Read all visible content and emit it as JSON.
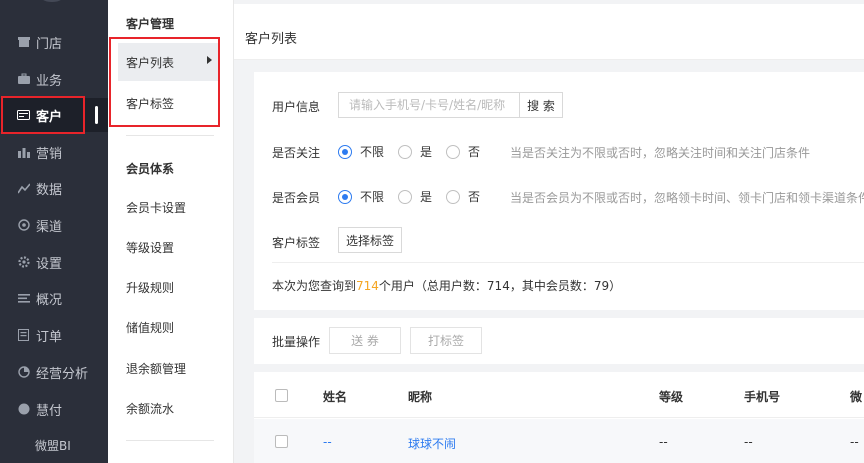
{
  "nav": {
    "items": [
      {
        "label": "门店",
        "icon": "store-icon"
      },
      {
        "label": "业务",
        "icon": "briefcase-icon"
      },
      {
        "label": "客户",
        "icon": "customer-card-icon"
      },
      {
        "label": "营销",
        "icon": "bar-chart-icon"
      },
      {
        "label": "数据",
        "icon": "trend-icon"
      },
      {
        "label": "渠道",
        "icon": "channel-icon"
      },
      {
        "label": "设置",
        "icon": "gear-icon"
      },
      {
        "label": "概况",
        "icon": "list-icon"
      },
      {
        "label": "订单",
        "icon": "order-icon"
      },
      {
        "label": "经营分析",
        "icon": "analysis-icon"
      },
      {
        "label": "慧付",
        "icon": "pay-icon"
      },
      {
        "label": "微盟BI",
        "icon": ""
      }
    ],
    "active_index": 2
  },
  "subnav": {
    "group1": "客户管理",
    "group1_items": [
      "客户列表",
      "客户标签"
    ],
    "group2": "会员体系",
    "group2_items": [
      "会员卡设置",
      "等级设置",
      "升级规则",
      "储值规则",
      "退余额管理",
      "余额流水"
    ]
  },
  "page": {
    "title": "客户列表"
  },
  "filter": {
    "user_info_label": "用户信息",
    "search_placeholder": "请输入手机号/卡号/姓名/昵称",
    "search_button": "搜 索",
    "follow_label": "是否关注",
    "member_label": "是否会员",
    "options": [
      "不限",
      "是",
      "否"
    ],
    "follow_hint": "当是否关注为不限或否时，忽略关注时间和关注门店条件",
    "member_hint": "当是否会员为不限或否时，忽略领卡时间、领卡门店和领卡渠道条件",
    "tag_label": "客户标签",
    "tag_button": "选择标签",
    "result_prefix": "本次为您查询到",
    "result_count": "714",
    "result_suffix": "个用户（总用户数：714，其中会员数：79）"
  },
  "batch": {
    "label": "批量操作",
    "send_coupon": "送 券",
    "tag": "打标签"
  },
  "table": {
    "headers": [
      "姓名",
      "昵称",
      "等级",
      "手机号",
      "微"
    ],
    "rows": [
      {
        "name": "--",
        "nickname": "球球不闹",
        "level": "--",
        "phone": "--",
        "extra": "--"
      }
    ]
  }
}
